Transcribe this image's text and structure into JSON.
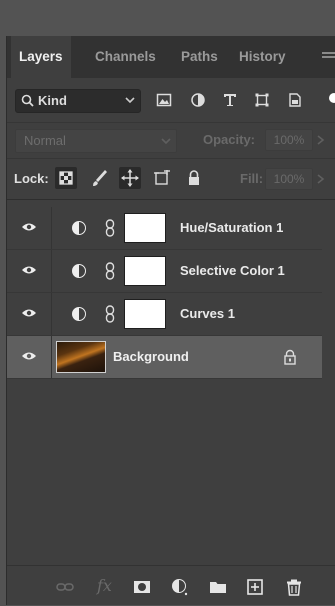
{
  "tabs": [
    {
      "label": "Layers",
      "active": true
    },
    {
      "label": "Channels",
      "active": false
    },
    {
      "label": "Paths",
      "active": false
    },
    {
      "label": "History",
      "active": false
    }
  ],
  "filter": {
    "kind_label": "Kind"
  },
  "blend": {
    "mode": "Normal",
    "opacity_label": "Opacity:",
    "opacity_value": "100%"
  },
  "lock": {
    "label": "Lock:",
    "fill_label": "Fill:",
    "fill_value": "100%"
  },
  "layers": [
    {
      "name": "Hue/Saturation 1",
      "type": "adjustment",
      "visible": true,
      "selected": false
    },
    {
      "name": "Selective Color 1",
      "type": "adjustment",
      "visible": true,
      "selected": false
    },
    {
      "name": "Curves 1",
      "type": "adjustment",
      "visible": true,
      "selected": false
    },
    {
      "name": "Background",
      "type": "image",
      "visible": true,
      "selected": true,
      "locked": true
    }
  ],
  "bottom_icons": [
    "link-layers-icon",
    "fx-icon",
    "add-mask-icon",
    "new-adjustment-icon",
    "new-group-icon",
    "new-layer-icon",
    "trash-icon"
  ],
  "colors": {
    "panel": "#3f3f3f",
    "tabbar": "#323232",
    "selected_row": "#5f5f5f"
  }
}
